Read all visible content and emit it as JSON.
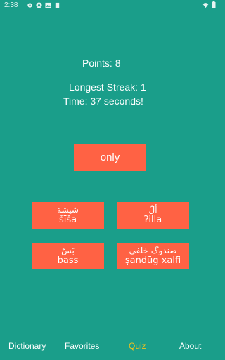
{
  "status_bar": {
    "time": "2:38",
    "icons_left": [
      "settings-icon",
      "app-icon",
      "image-icon",
      "storage-icon"
    ],
    "icons_right": [
      "wifi-icon",
      "battery-icon"
    ]
  },
  "quiz": {
    "points": "Points: 8",
    "longest_streak": "Longest Streak: 1",
    "time": "Time: 37 seconds!",
    "word": "only",
    "options": [
      {
        "arabic": "شيشة",
        "translit": "šīša"
      },
      {
        "arabic": "ألّ",
        "translit": "ʔilla"
      },
      {
        "arabic": "بَسّ",
        "translit": "bass"
      },
      {
        "arabic": "صندوگ خلفي",
        "translit": "ṣandūg xalfi"
      }
    ]
  },
  "nav": {
    "items": [
      "Dictionary",
      "Favorites",
      "Quiz",
      "About"
    ],
    "active_index": 2
  },
  "colors": {
    "background": "#1a9e8a",
    "button": "#ff6244",
    "active_nav": "#f2c21b",
    "text": "#ffffff"
  }
}
